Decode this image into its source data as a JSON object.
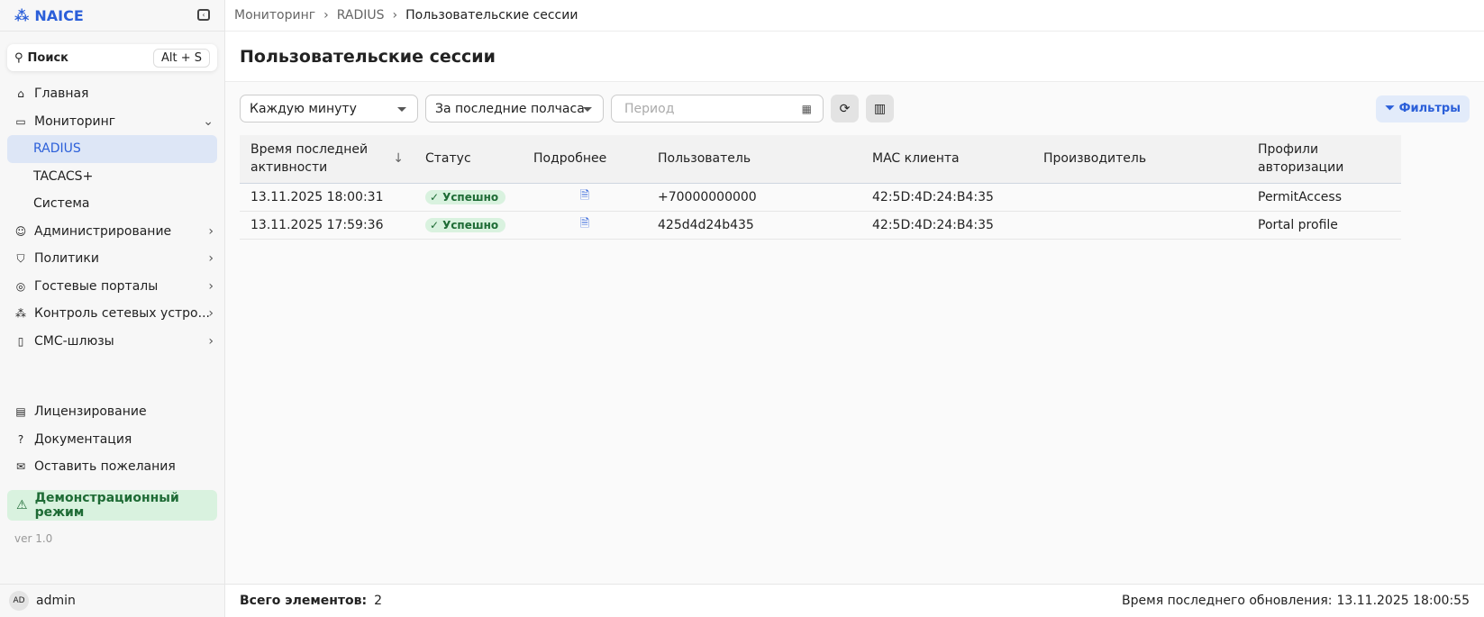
{
  "app": {
    "name": "NAICE"
  },
  "search": {
    "label": "Поиск",
    "shortcut": "Alt + S"
  },
  "nav": {
    "home": "Главная",
    "monitoring": "Мониторинг",
    "radius": "RADIUS",
    "tacacs": "TACACS+",
    "system": "Система",
    "admin": "Администрирование",
    "policies": "Политики",
    "portals": "Гостевые порталы",
    "devices": "Контроль сетевых устро...",
    "sms": "СМС-шлюзы",
    "licensing": "Лицензирование",
    "docs": "Документация",
    "feedback": "Оставить пожелания"
  },
  "demo": "Демонстрационный режим",
  "version": "ver 1.0",
  "user": {
    "initials": "AD",
    "name": "admin"
  },
  "breadcrumb": [
    "Мониторинг",
    "RADIUS",
    "Пользовательские сессии"
  ],
  "page_title": "Пользовательские сессии",
  "toolbar": {
    "refresh_interval": "Каждую минуту",
    "time_range": "За последние полчаса",
    "period_placeholder": "Период",
    "filters": "Фильтры"
  },
  "table": {
    "headers": [
      "Время последней активности",
      "Статус",
      "Подробнее",
      "Пользователь",
      "MAC клиента",
      "Производитель",
      "Профили авторизации"
    ],
    "rows": [
      {
        "time": "13.11.2025 18:00:31",
        "status": "Успешно",
        "user": "+70000000000",
        "mac": "42:5D:4D:24:B4:35",
        "vendor": "",
        "profile": "PermitAccess"
      },
      {
        "time": "13.11.2025 17:59:36",
        "status": "Успешно",
        "user": "425d4d24b435",
        "mac": "42:5D:4D:24:B4:35",
        "vendor": "",
        "profile": "Portal profile"
      }
    ]
  },
  "footer": {
    "total_label": "Всего элементов:",
    "total": "2",
    "updated_label": "Время последнего обновления:",
    "updated": "13.11.2025 18:00:55"
  }
}
